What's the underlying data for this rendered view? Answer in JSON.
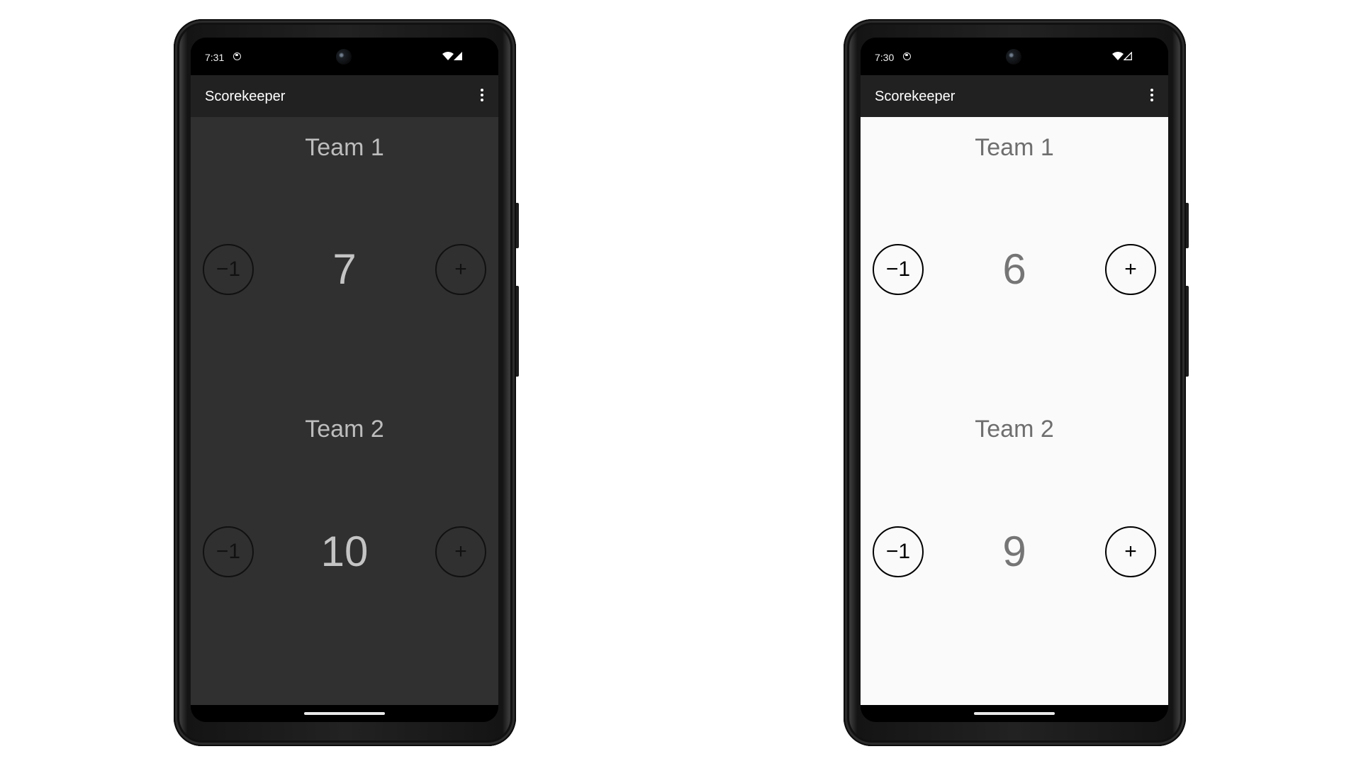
{
  "devices": [
    {
      "theme": "dark",
      "status_bar": {
        "time": "7:31",
        "notification_icon": "app-notification-icon",
        "wifi_icon": "wifi-icon",
        "signal_icon": "signal-full-icon"
      },
      "app_bar": {
        "title": "Scorekeeper",
        "overflow_icon": "more-vert-icon"
      },
      "teams": [
        {
          "label": "Team 1",
          "score": "7",
          "decrement_label": "−1",
          "increment_label": "+"
        },
        {
          "label": "Team 2",
          "score": "10",
          "decrement_label": "−1",
          "increment_label": "+"
        }
      ]
    },
    {
      "theme": "light",
      "status_bar": {
        "time": "7:30",
        "notification_icon": "app-notification-icon",
        "wifi_icon": "wifi-icon",
        "signal_icon": "signal-empty-icon"
      },
      "app_bar": {
        "title": "Scorekeeper",
        "overflow_icon": "more-vert-icon"
      },
      "teams": [
        {
          "label": "Team 1",
          "score": "6",
          "decrement_label": "−1",
          "increment_label": "+"
        },
        {
          "label": "Team 2",
          "score": "9",
          "decrement_label": "−1",
          "increment_label": "+"
        }
      ]
    }
  ],
  "colors": {
    "app_bar_bg": "#212121",
    "dark_content_bg": "#303030",
    "light_content_bg": "#fafafa",
    "dark_text": "#bdbdbd",
    "light_text": "#6e6e6e"
  }
}
